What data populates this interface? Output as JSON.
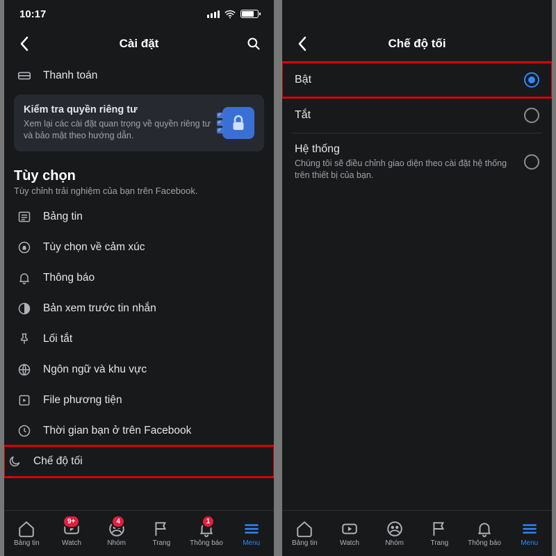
{
  "left": {
    "status_time": "10:17",
    "header_title": "Cài đặt",
    "payment_label": "Thanh toán",
    "privacy": {
      "title": "Kiểm tra quyền riêng tư",
      "sub": "Xem lại các cài đặt quan trọng về quyền riêng tư và bảo mật theo hướng dẫn."
    },
    "section": {
      "title": "Tùy chọn",
      "sub": "Tùy chỉnh trải nghiệm của bạn trên Facebook."
    },
    "options": [
      {
        "label": "Bảng tin"
      },
      {
        "label": "Tùy chọn về cảm xúc"
      },
      {
        "label": "Thông báo"
      },
      {
        "label": "Bản xem trước tin nhắn"
      },
      {
        "label": "Lối tắt"
      },
      {
        "label": "Ngôn ngữ và khu vực"
      },
      {
        "label": "File phương tiện"
      },
      {
        "label": "Thời gian bạn ở trên Facebook"
      },
      {
        "label": "Chế độ tối"
      }
    ],
    "tabs": [
      {
        "label": "Bảng tin"
      },
      {
        "label": "Watch",
        "badge": "9+"
      },
      {
        "label": "Nhóm",
        "badge": "4"
      },
      {
        "label": "Trang"
      },
      {
        "label": "Thông báo",
        "badge": "1"
      },
      {
        "label": "Menu"
      }
    ]
  },
  "right": {
    "header_title": "Chế độ tối",
    "options": [
      {
        "label": "Bật",
        "selected": true
      },
      {
        "label": "Tắt",
        "selected": false
      },
      {
        "label": "Hệ thống",
        "sub": "Chúng tôi sẽ điều chỉnh giao diện theo cài đặt hệ thống trên thiết bị của bạn.",
        "selected": false
      }
    ],
    "tabs": [
      {
        "label": "Bảng tin"
      },
      {
        "label": "Watch"
      },
      {
        "label": "Nhóm"
      },
      {
        "label": "Trang"
      },
      {
        "label": "Thông báo"
      },
      {
        "label": "Menu"
      }
    ]
  },
  "colors": {
    "accent": "#2e89ff",
    "highlight_box": "#d8000c",
    "bg": "#18191a"
  }
}
